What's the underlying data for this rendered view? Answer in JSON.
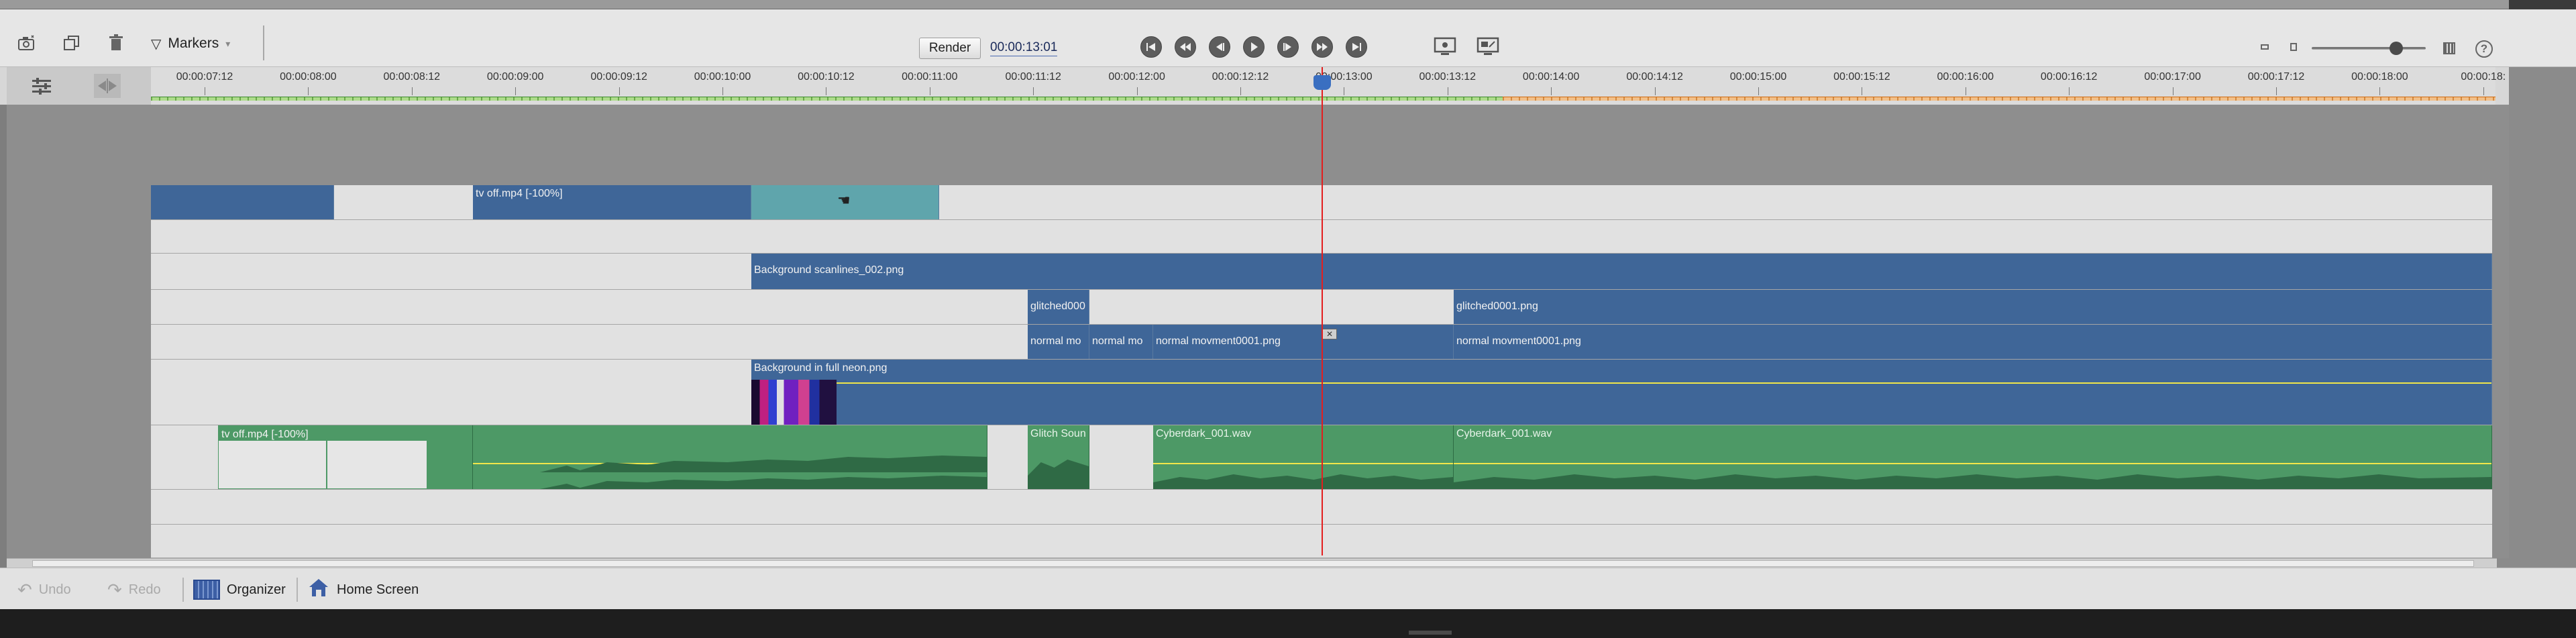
{
  "toolbar": {
    "markers_label": "Markers",
    "render_label": "Render",
    "timecode": "00:00:13:01"
  },
  "ruler": {
    "ticks": [
      "00:00:07:12",
      "00:00:08:00",
      "00:00:08:12",
      "00:00:09:00",
      "00:00:09:12",
      "00:00:10:00",
      "00:00:10:12",
      "00:00:11:00",
      "00:00:11:12",
      "00:00:12:00",
      "00:00:12:12",
      "00:00:13:00",
      "00:00:13:12",
      "00:00:14:00",
      "00:00:14:12",
      "00:00:15:00",
      "00:00:15:12",
      "00:00:16:00",
      "00:00:16:12",
      "00:00:17:00",
      "00:00:17:12",
      "00:00:18:00",
      "00:00:18:"
    ]
  },
  "clips": {
    "tv_off_video": "tv off.mp4 [-100%]",
    "bg_scanlines": "Background scanlines_002.png",
    "glitched_short": "glitched000",
    "glitched_long": "glitched0001.png",
    "normal_a": "normal mo",
    "normal_b": "normal mo",
    "normal_c": "normal movment0001.png",
    "normal_d": "normal movment0001.png",
    "bg_neon": "Background in full neon.png",
    "tv_off_audio": "tv off.mp4 [-100%]",
    "glitch_sound": "Glitch Soun",
    "cyberdark_a": "Cyberdark_001.wav",
    "cyberdark_b": "Cyberdark_001.wav"
  },
  "bottom": {
    "undo": "Undo",
    "redo": "Redo",
    "organizer": "Organizer",
    "home_screen": "Home Screen"
  },
  "colors": {
    "video_clip": "#3f6698",
    "audio_clip": "#4d9966",
    "selected_clip": "#5fa5ac",
    "playhead": "#e41e1e"
  }
}
